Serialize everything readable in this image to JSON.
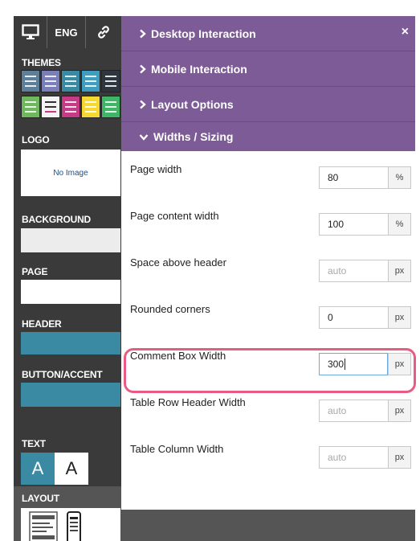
{
  "sidebar": {
    "lang_label": "ENG",
    "themes_label": "THEMES",
    "logo_label": "LOGO",
    "logo_placeholder": "No Image",
    "background_label": "BACKGROUND",
    "page_label": "PAGE",
    "header_label": "HEADER",
    "accent_label": "BUTTON/ACCENT",
    "text_label": "TEXT",
    "text_sample_dark": "A",
    "text_sample_light": "A",
    "layout_label": "LAYOUT",
    "theme_colors": [
      "#5e7f9a",
      "#7b7fb8",
      "#3a8aa3",
      "#3f9ec0",
      "#2f3640",
      "#6fb85e",
      "#f3f3f3",
      "#c73b86",
      "#f5d832",
      "#3fb568"
    ],
    "header_color": "#3a8aa3",
    "accent_color": "#3a8aa3",
    "background_color": "#ececec",
    "page_color": "#ffffff"
  },
  "panel": {
    "sections": [
      {
        "label": "Desktop Interaction",
        "icon": "chevron-right-icon",
        "expanded": false
      },
      {
        "label": "Mobile Interaction",
        "icon": "chevron-right-icon",
        "expanded": false
      },
      {
        "label": "Layout Options",
        "icon": "chevron-right-icon",
        "expanded": false
      },
      {
        "label": "Widths / Sizing",
        "icon": "chevron-down-icon",
        "expanded": true
      }
    ],
    "close_icon": "×",
    "accent_color": "#7d5b96",
    "rows": [
      {
        "label": "Page width",
        "value": "80",
        "placeholder": "",
        "unit": "%"
      },
      {
        "label": "Page content width",
        "value": "100",
        "placeholder": "",
        "unit": "%"
      },
      {
        "label": "Space above header",
        "value": "",
        "placeholder": "auto",
        "unit": "px"
      },
      {
        "label": "Rounded corners",
        "value": "0",
        "placeholder": "",
        "unit": "px"
      },
      {
        "label": "Comment Box Width",
        "value": "300",
        "placeholder": "",
        "unit": "px"
      },
      {
        "label": "Table Row Header Width",
        "value": "",
        "placeholder": "auto",
        "unit": "px"
      },
      {
        "label": "Table Column Width",
        "value": "",
        "placeholder": "auto",
        "unit": "px"
      }
    ],
    "highlight_color": "#e85b83"
  }
}
